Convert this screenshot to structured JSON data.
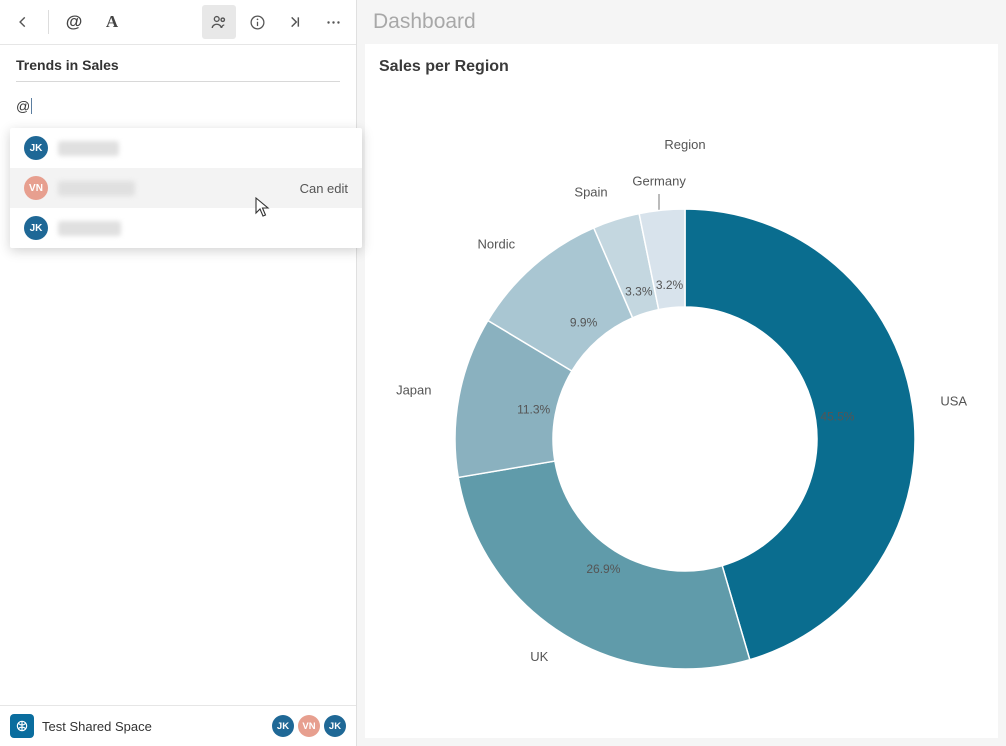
{
  "header": {
    "title": "Dashboard"
  },
  "sidebar": {
    "section_title": "Trends in Sales",
    "input_value": "@",
    "mentions": [
      {
        "initials": "JK",
        "name": "John Kline",
        "color": "#1f6896",
        "role": ""
      },
      {
        "initials": "VN",
        "name": "Vera Norman",
        "color": "#e79f8f",
        "role": "Can edit",
        "highlight": true
      },
      {
        "initials": "JK",
        "name": "Jamie Kerr",
        "color": "#1f6896",
        "role": ""
      }
    ]
  },
  "footer": {
    "space_name": "Test Shared Space",
    "avatars": [
      {
        "initials": "JK",
        "color": "#1f6896"
      },
      {
        "initials": "VN",
        "color": "#e79f8f"
      },
      {
        "initials": "JK",
        "color": "#1f6896"
      }
    ]
  },
  "card": {
    "title": "Sales per Region",
    "legend_title": "Region"
  },
  "chart_data": {
    "type": "pie",
    "title": "Sales per Region",
    "legend_title": "Region",
    "donut": true,
    "series": [
      {
        "name": "USA",
        "value": 45.5,
        "color": "#0a6d8f"
      },
      {
        "name": "UK",
        "value": 26.9,
        "color": "#609baa"
      },
      {
        "name": "Japan",
        "value": 11.3,
        "color": "#8ab1bf"
      },
      {
        "name": "Nordic",
        "value": 9.9,
        "color": "#a9c6d2"
      },
      {
        "name": "Spain",
        "value": 3.3,
        "color": "#c4d7e0"
      },
      {
        "name": "Germany",
        "value": 3.2,
        "color": "#d8e3ec"
      }
    ]
  }
}
